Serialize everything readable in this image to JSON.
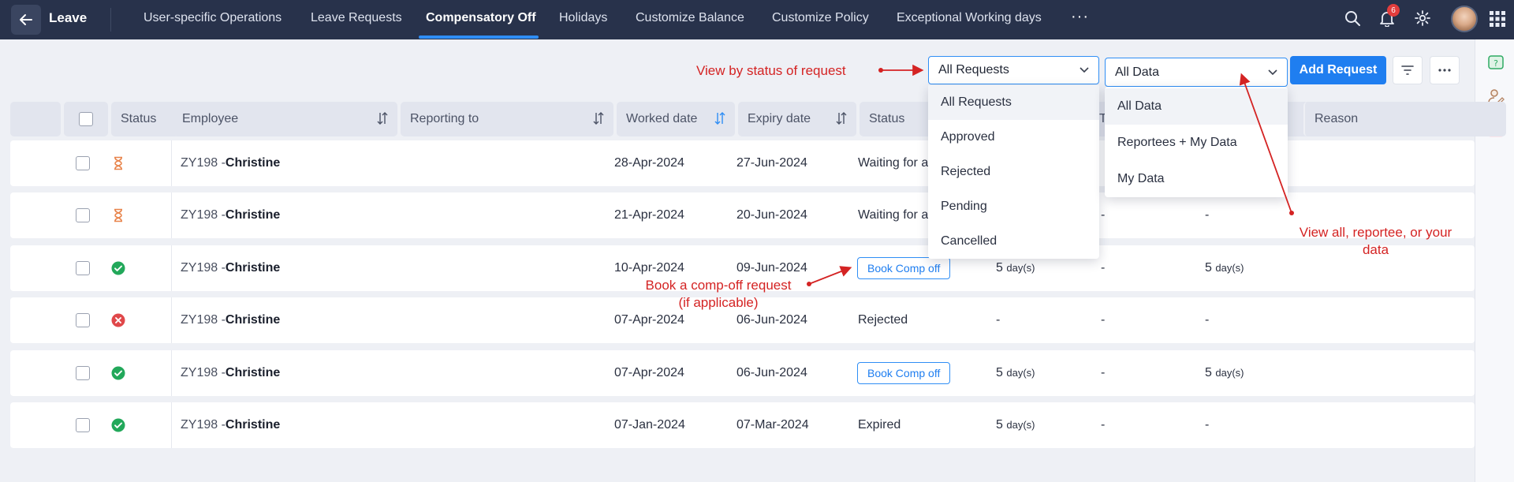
{
  "header": {
    "app_title": "Leave",
    "tabs": [
      {
        "label": "User-specific Operations"
      },
      {
        "label": "Leave Requests"
      },
      {
        "label": "Compensatory Off"
      },
      {
        "label": "Holidays"
      },
      {
        "label": "Customize Balance"
      },
      {
        "label": "Customize Policy"
      },
      {
        "label": "Exceptional Working days"
      }
    ],
    "more": "···",
    "notification_count": "6"
  },
  "toolbar": {
    "status_filter_value": "All Requests",
    "data_filter_value": "All Data",
    "add_request_label": "Add Request"
  },
  "status_menu": [
    "All Requests",
    "Approved",
    "Rejected",
    "Pending",
    "Cancelled"
  ],
  "data_menu": [
    "All Data",
    "Reportees + My Data",
    "My Data"
  ],
  "annotations": {
    "status": "View by status of request",
    "data_line1": "View all, reportee, or your",
    "data_line2": "data",
    "book_line1": "Book a comp-off request",
    "book_line2": "(if applicable)"
  },
  "table": {
    "columns": {
      "status_icon": "Status",
      "employee": "Employee",
      "reporting_to": "Reporting to",
      "worked_date": "Worked date",
      "expiry_date": "Expiry date",
      "status": "Status",
      "reason": "Reason",
      "partial_t": "T"
    },
    "rows": [
      {
        "state": "pending",
        "emp_code": "ZY198 -",
        "emp_name": "Christine",
        "worked": "28-Apr-2024",
        "expiry": "27-Jun-2024",
        "status": "Waiting for a",
        "c1": "",
        "c2": "",
        "c3": ""
      },
      {
        "state": "pending",
        "emp_code": "ZY198 -",
        "emp_name": "Christine",
        "worked": "21-Apr-2024",
        "expiry": "20-Jun-2024",
        "status": "Waiting for a",
        "c1": "",
        "c2": "-",
        "c3": "-"
      },
      {
        "state": "approved",
        "emp_code": "ZY198 -",
        "emp_name": "Christine",
        "worked": "10-Apr-2024",
        "expiry": "09-Jun-2024",
        "status": "Book Comp off",
        "c1": "5",
        "c2": "-",
        "c3": "5"
      },
      {
        "state": "rejected",
        "emp_code": "ZY198 -",
        "emp_name": "Christine",
        "worked": "07-Apr-2024",
        "expiry": "06-Jun-2024",
        "status": "Rejected",
        "c1": "-",
        "c2": "-",
        "c3": "-"
      },
      {
        "state": "approved",
        "emp_code": "ZY198 -",
        "emp_name": "Christine",
        "worked": "07-Apr-2024",
        "expiry": "06-Jun-2024",
        "status": "Book Comp off",
        "c1": "5",
        "c2": "-",
        "c3": "5"
      },
      {
        "state": "approved",
        "emp_code": "ZY198 -",
        "emp_name": "Christine",
        "worked": "07-Jan-2024",
        "expiry": "07-Mar-2024",
        "status": "Expired",
        "c1": "5",
        "c2": "-",
        "c3": "-"
      }
    ],
    "day_unit": "day(s)"
  },
  "colors": {
    "nav_bg": "#28324b",
    "accent": "#1f7ef0",
    "annotation": "#d42323",
    "approved": "#22a85a",
    "rejected": "#e0484a",
    "pending": "#e8834a"
  }
}
